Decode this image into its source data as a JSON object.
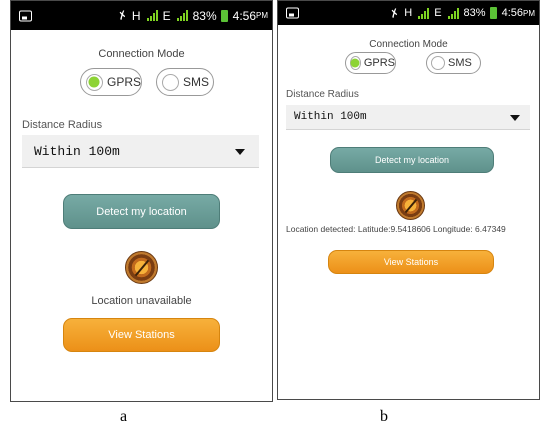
{
  "status_bar": {
    "network_h": "H",
    "network_e": "E",
    "battery": "83%",
    "time": "4:56",
    "time_suffix": "PM"
  },
  "connection_mode_label": "Connection Mode",
  "radio": {
    "gprs_label": "GPRS",
    "sms_label": "SMS",
    "selected": "GPRS"
  },
  "distance_radius_label": "Distance Radius",
  "distance_radius_value": "Within 100m",
  "detect_button_label": "Detect my location",
  "view_button_label": "View Stations",
  "panel_a": {
    "location_status": "Location unavailable",
    "caption": "a"
  },
  "panel_b": {
    "location_status": "Location detected: Latitude:9.5418606 Longitude: 6.47349",
    "caption": "b"
  },
  "colors": {
    "teal_button": "#6a9c96",
    "orange_button": "#f2a12a",
    "radio_selected": "#8dd335"
  },
  "icons": {
    "status_app": "image-icon",
    "mute": "mute-icon",
    "signal": "signal-icon",
    "battery": "battery-icon",
    "compass": "compass-icon",
    "dropdown": "chevron-down-icon"
  }
}
